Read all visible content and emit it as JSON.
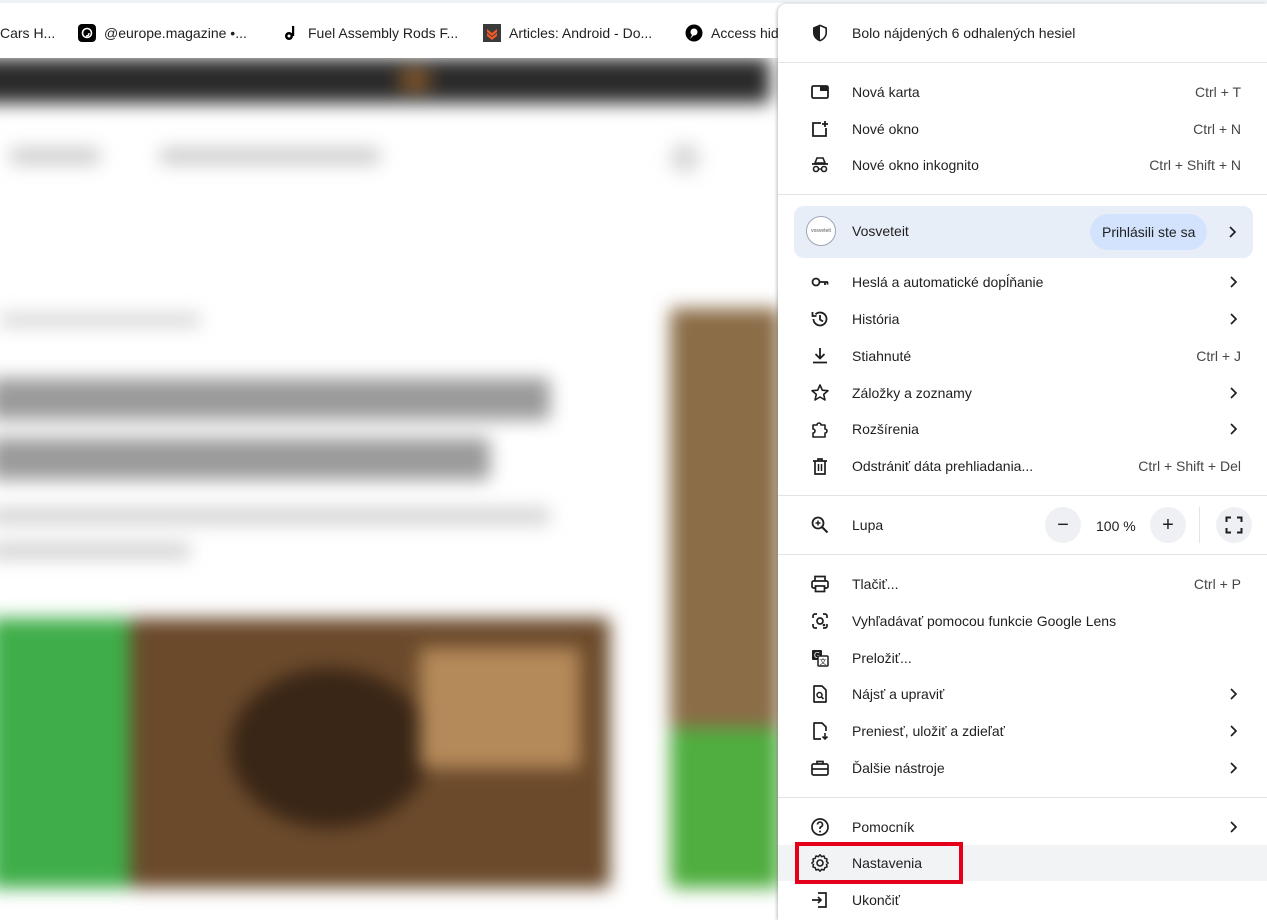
{
  "bookmarks": [
    {
      "label": "Cars H...",
      "icon": "none"
    },
    {
      "label": "@europe.magazine •...",
      "icon": "threads-icon"
    },
    {
      "label": "Fuel Assembly Rods F...",
      "icon": "music-note-icon"
    },
    {
      "label": "Articles: Android - Do...",
      "icon": "orange-chevron-icon"
    },
    {
      "label": "Access hid",
      "icon": "speech-bubble-icon"
    }
  ],
  "menu": {
    "password_alert": "Bolo nájdených 6 odhalených hesiel",
    "new_tab": {
      "label": "Nová karta",
      "shortcut": "Ctrl + T"
    },
    "new_window": {
      "label": "Nové okno",
      "shortcut": "Ctrl + N"
    },
    "incognito": {
      "label": "Nové okno inkognito",
      "shortcut": "Ctrl + Shift + N"
    },
    "profile": {
      "name": "Vosveteit",
      "avatar_text": "vosveteit",
      "status": "Prihlásili ste sa"
    },
    "passwords": {
      "label": "Heslá a automatické dopĺňanie"
    },
    "history": {
      "label": "História"
    },
    "downloads": {
      "label": "Stiahnuté",
      "shortcut": "Ctrl + J"
    },
    "bookmarks": {
      "label": "Záložky a zoznamy"
    },
    "extensions": {
      "label": "Rozšírenia"
    },
    "clear_data": {
      "label": "Odstrániť dáta prehliadania...",
      "shortcut": "Ctrl + Shift + Del"
    },
    "zoom": {
      "label": "Lupa",
      "value": "100 %",
      "minus": "−",
      "plus": "+"
    },
    "print": {
      "label": "Tlačiť...",
      "shortcut": "Ctrl + P"
    },
    "lens": {
      "label": "Vyhľadávať pomocou funkcie Google Lens"
    },
    "translate": {
      "label": "Preložiť..."
    },
    "find": {
      "label": "Nájsť a upraviť"
    },
    "cast": {
      "label": "Preniesť, uložiť a zdieľať"
    },
    "more_tools": {
      "label": "Ďalšie nástroje"
    },
    "help": {
      "label": "Pomocník"
    },
    "settings": {
      "label": "Nastavenia"
    },
    "exit": {
      "label": "Ukončiť"
    }
  },
  "colors": {
    "highlight_border": "#e4001b",
    "profile_bg": "#e8eef8",
    "badge_bg": "#d3e3fd"
  }
}
